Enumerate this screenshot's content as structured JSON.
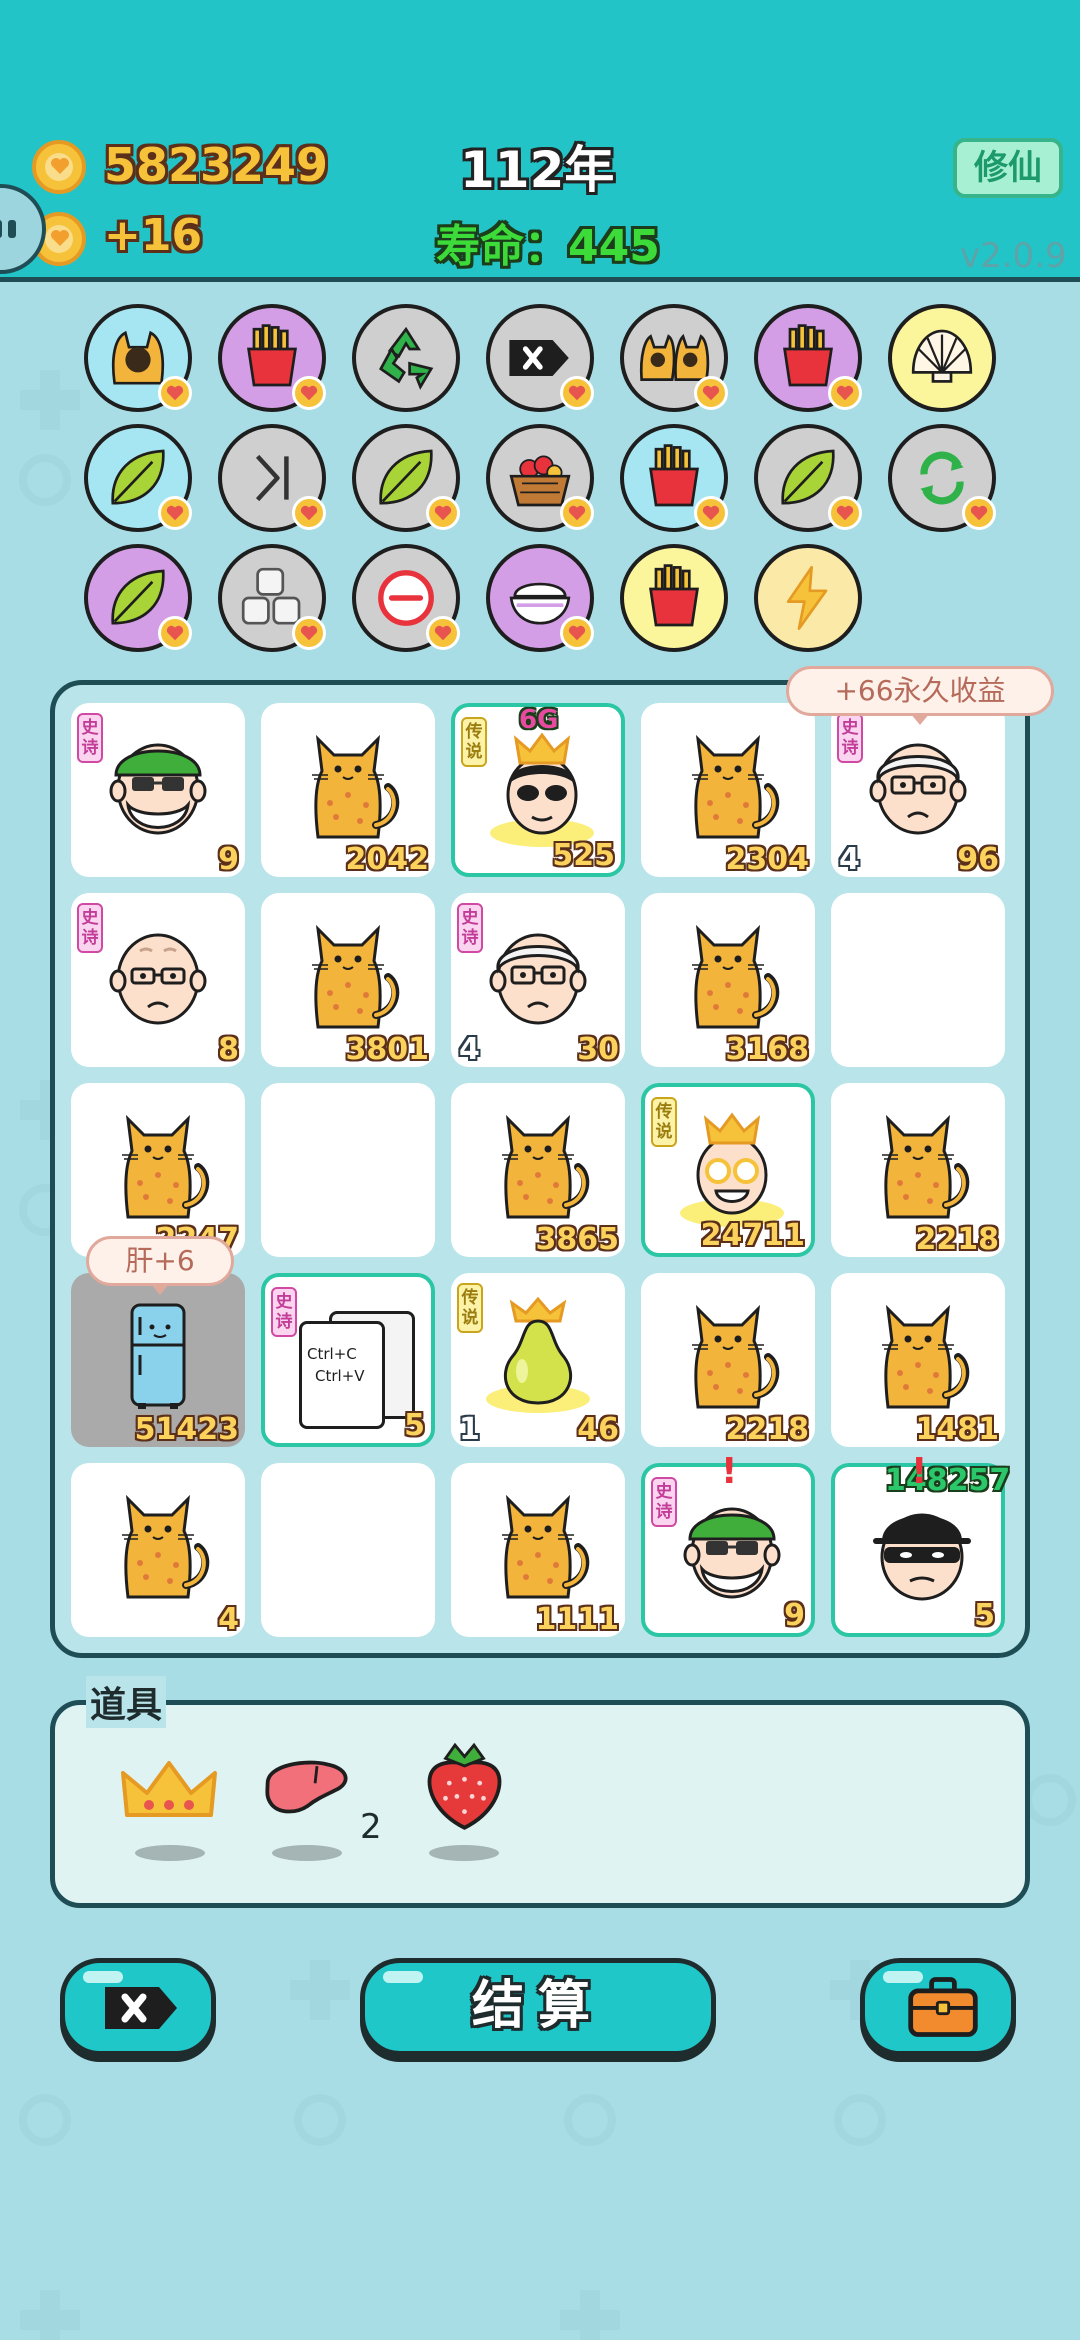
{
  "header": {
    "coins": "5823249",
    "coin_rate": "+16",
    "year": "112年",
    "lifespan": "寿命：445",
    "cultivate_button": "修仙",
    "version": "v2.0.9"
  },
  "skills": [
    {
      "icon": "cat-face-skill-icon",
      "bg": "#a6e6f3",
      "badge": true
    },
    {
      "icon": "fries-skill-icon",
      "bg": "#d39ee5",
      "badge": true
    },
    {
      "icon": "recycle-skill-icon",
      "bg": "#cfcfcf",
      "badge": false
    },
    {
      "icon": "delete-tag-skill-icon",
      "bg": "#cfcfcf",
      "badge": true
    },
    {
      "icon": "twin-cats-skill-icon",
      "bg": "#cfcfcf",
      "badge": true
    },
    {
      "icon": "fries-skill-icon",
      "bg": "#d39ee5",
      "badge": true
    },
    {
      "icon": "shell-skill-icon",
      "bg": "#fbf59c",
      "badge": false
    },
    {
      "icon": "leaf-skill-icon",
      "bg": "#a6e6f3",
      "badge": true
    },
    {
      "icon": "skip-skill-icon",
      "bg": "#cfcfcf",
      "badge": true
    },
    {
      "icon": "leaf-skill-icon",
      "bg": "#cfcfcf",
      "badge": true
    },
    {
      "icon": "fruit-basket-skill-icon",
      "bg": "#cfcfcf",
      "badge": true
    },
    {
      "icon": "fries-skill-icon",
      "bg": "#a6e6f3",
      "badge": true
    },
    {
      "icon": "leaf-skill-icon",
      "bg": "#cfcfcf",
      "badge": true
    },
    {
      "icon": "refresh-skill-icon",
      "bg": "#cfcfcf",
      "badge": true
    },
    {
      "icon": "leaf-skill-icon",
      "bg": "#d39ee5",
      "badge": true
    },
    {
      "icon": "cubes-skill-icon",
      "bg": "#cfcfcf",
      "badge": true
    },
    {
      "icon": "minus-skill-icon",
      "bg": "#cfcfcf",
      "badge": true
    },
    {
      "icon": "rice-bowl-skill-icon",
      "bg": "#d39ee5",
      "badge": true
    },
    {
      "icon": "fries-skill-icon",
      "bg": "#fbf59c",
      "badge": false
    },
    {
      "icon": "lightning-skill-icon",
      "bg": "#fbe9a8",
      "badge": false
    }
  ],
  "board": {
    "bubble_income": "+66永久收益",
    "bubble_liver": "肝+6",
    "cells": [
      {
        "type": "green-hat-old-man",
        "tag": "史诗",
        "tag_kind": "epic",
        "value": "9",
        "left": "",
        "hl": false
      },
      {
        "type": "cat",
        "tag": "",
        "value": "2042",
        "left": "",
        "hl": false
      },
      {
        "type": "king-sunglasses",
        "tag": "传说",
        "tag_kind": "legend",
        "value": "525",
        "left": "",
        "top": "6G",
        "hl": true
      },
      {
        "type": "cat",
        "tag": "",
        "value": "2304",
        "left": "",
        "hl": false
      },
      {
        "type": "white-hair-old-man",
        "tag": "史诗",
        "tag_kind": "epic",
        "value": "96",
        "left": "4",
        "hl": false
      },
      {
        "type": "bald-old-man",
        "tag": "史诗",
        "tag_kind": "epic",
        "value": "8",
        "left": "",
        "hl": false
      },
      {
        "type": "cat",
        "tag": "",
        "value": "3801",
        "left": "",
        "hl": false
      },
      {
        "type": "white-hair-old-man",
        "tag": "史诗",
        "tag_kind": "epic",
        "value": "30",
        "left": "4",
        "hl": false
      },
      {
        "type": "cat",
        "tag": "",
        "value": "3168",
        "left": "",
        "hl": false
      },
      {
        "type": "empty",
        "tag": "",
        "value": "",
        "left": "",
        "hl": false
      },
      {
        "type": "cat",
        "tag": "",
        "value": "2247",
        "left": "",
        "hl": false
      },
      {
        "type": "empty",
        "tag": "",
        "value": "",
        "left": "",
        "hl": false
      },
      {
        "type": "cat",
        "tag": "",
        "value": "3865",
        "left": "",
        "hl": false
      },
      {
        "type": "king-gold-glasses",
        "tag": "传说",
        "tag_kind": "legend",
        "value": "24711",
        "left": "",
        "hl": true
      },
      {
        "type": "cat",
        "tag": "",
        "value": "2218",
        "left": "",
        "hl": false
      },
      {
        "type": "fridge",
        "tag": "",
        "value": "51423",
        "left": "",
        "hl": false,
        "gray": true
      },
      {
        "type": "ctrl-cv",
        "tag": "史诗",
        "tag_kind": "epic",
        "value": "5",
        "left": "",
        "hl": true,
        "cv1": "Ctrl+C",
        "cv2": "Ctrl+V"
      },
      {
        "type": "pear",
        "tag": "传说",
        "tag_kind": "legend",
        "value": "46",
        "left": "1",
        "hl": false
      },
      {
        "type": "cat",
        "tag": "",
        "value": "2218",
        "left": "",
        "hl": false
      },
      {
        "type": "cat",
        "tag": "",
        "value": "1481",
        "left": "",
        "hl": false
      },
      {
        "type": "cat",
        "tag": "",
        "value": "4",
        "left": "",
        "hl": false
      },
      {
        "type": "empty",
        "tag": "",
        "value": "",
        "left": "",
        "hl": false
      },
      {
        "type": "cat",
        "tag": "",
        "value": "1111",
        "left": "",
        "hl": false
      },
      {
        "type": "green-hat-old-man",
        "tag": "史诗",
        "tag_kind": "epic",
        "value": "9",
        "left": "",
        "hl": true,
        "excl": "!"
      },
      {
        "type": "thief",
        "tag": "",
        "value": "5",
        "left": "",
        "hl": true,
        "excl": "!",
        "top": "148257"
      }
    ]
  },
  "items": {
    "title": "道具",
    "list": [
      {
        "icon": "crown-item-icon",
        "count": ""
      },
      {
        "icon": "liver-item-icon",
        "count": "2"
      },
      {
        "icon": "strawberry-item-icon",
        "count": ""
      }
    ]
  },
  "buttons": {
    "settle": "结算"
  }
}
